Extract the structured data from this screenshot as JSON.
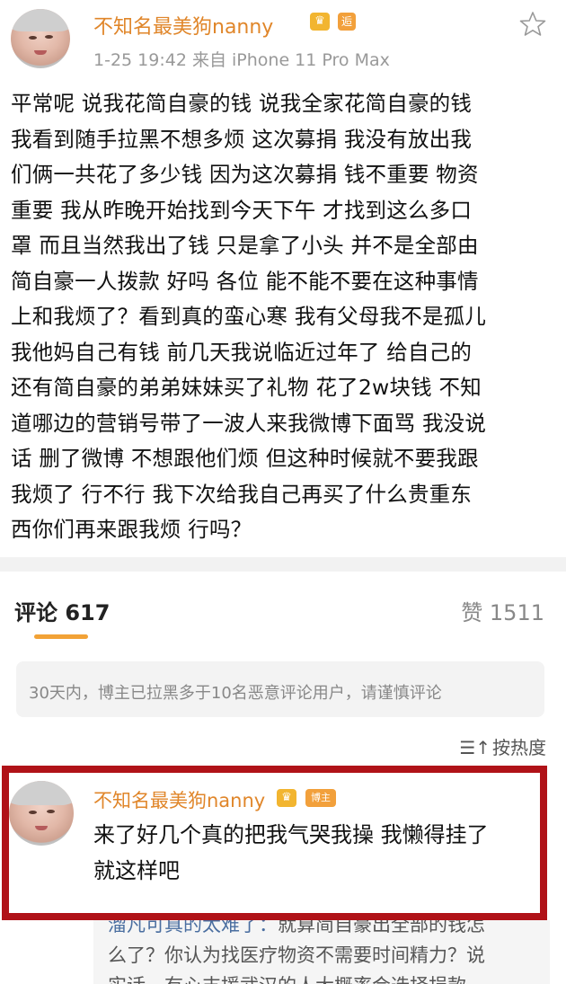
{
  "post": {
    "author": "不知名最美狗nanny",
    "meta": "1-25 19:42   来自 iPhone 11 Pro Max",
    "badge_square": "逅",
    "lines": [
      "平常呢 说我花简自豪的钱 说我全家花简自豪的钱",
      "我看到随手拉黑不想多烦 这次募捐 我没有放出我",
      "们俩一共花了多少钱 因为这次募捐 钱不重要 物资",
      "重要 我从昨晚开始找到今天下午 才找到这么多口",
      "罩 而且当然我出了钱 只是拿了小头 并不是全部由",
      "简自豪一人拨款 好吗 各位 能不能不要在这种事情",
      "上和我烦了？看到真的蛮心寒 我有父母我不是孤儿",
      "我他妈自己有钱 前几天我说临近过年了 给自己的",
      "还有简自豪的弟弟妹妹买了礼物 花了2w块钱 不知",
      "道哪边的营销号带了一波人来我微博下面骂 我没说",
      "话 删了微博 不想跟他们烦 但这种时候就不要我跟",
      "我烦了 行不行 我下次给我自己再买了什么贵重东",
      "西你们再来跟我烦 行吗？"
    ]
  },
  "tabs": {
    "comments_label": "评论 617",
    "likes_label": "赞 1511"
  },
  "notice": "30天内，博主已拉黑多于10名恶意评论用户，请谨慎评论",
  "sort": {
    "icon": "sort-lines-icon",
    "label": "按热度"
  },
  "comment": {
    "author": "不知名最美狗nanny",
    "badge": "博主",
    "text_line1": "来了好几个真的把我气哭我操 我懒得挂了",
    "text_line2": "就这样吧"
  },
  "reply": {
    "line1_user": "溜凡可真的太难了：",
    "line1_text": "就算简自豪出全部的钱怎",
    "line2": "么了？你认为找医疗物资不需要时间精力？说",
    "line3": "实话，有心支援武汉的人大概率会选择捐款"
  },
  "colors": {
    "name_orange": "#e0862a",
    "tab_underline": "#f2a236",
    "highlight_red": "#b01218"
  }
}
